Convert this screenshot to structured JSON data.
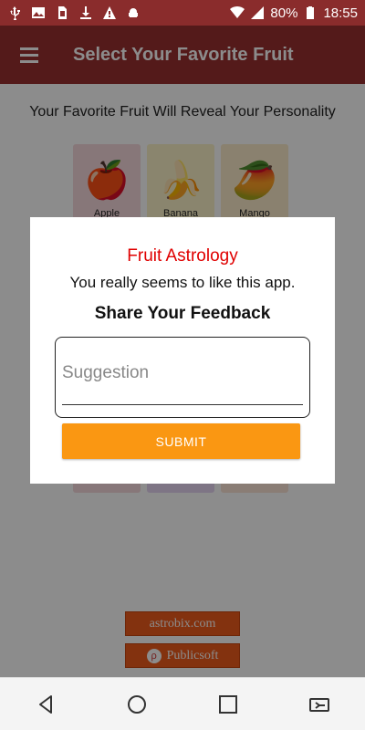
{
  "status_bar": {
    "battery_percent": "80%",
    "time": "18:55",
    "left_icons": [
      "usb-icon",
      "image-icon",
      "sim-icon",
      "download-icon",
      "warning-icon",
      "android-debug-icon"
    ],
    "right_icons": [
      "wifi-icon",
      "signal-icon",
      "battery-icon"
    ]
  },
  "app_bar": {
    "title": "Select Your Favorite Fruit",
    "menu_icon": "hamburger-menu-icon"
  },
  "main": {
    "subtitle": "Your Favorite Fruit Will Reveal Your Personality",
    "fruits": [
      {
        "label": "Apple",
        "emoji": "🍎",
        "color": "#f6d9dc"
      },
      {
        "label": "Banana",
        "emoji": "🍌",
        "color": "#fbf3c8"
      },
      {
        "label": "Mango",
        "emoji": "🥭",
        "color": "#fbeccb"
      }
    ]
  },
  "footer": {
    "astrobix_label": "astrobix.com",
    "publicsoft_label": "Publicsoft"
  },
  "dialog": {
    "title": "Fruit Astrology",
    "message": "You really seems to like this app.",
    "subtitle": "Share Your Feedback",
    "input_placeholder": "Suggestion",
    "input_value": "",
    "submit_label": "SUBMIT"
  },
  "colors": {
    "status_bar": "#8a2c2c",
    "app_bar": "#9a3030",
    "dialog_title": "#e00000",
    "submit": "#fa9712",
    "footer_button": "#ef5b1d"
  },
  "nav_bar": {
    "icons": [
      "back-icon",
      "home-icon",
      "recents-icon",
      "screen-switch-icon"
    ]
  }
}
